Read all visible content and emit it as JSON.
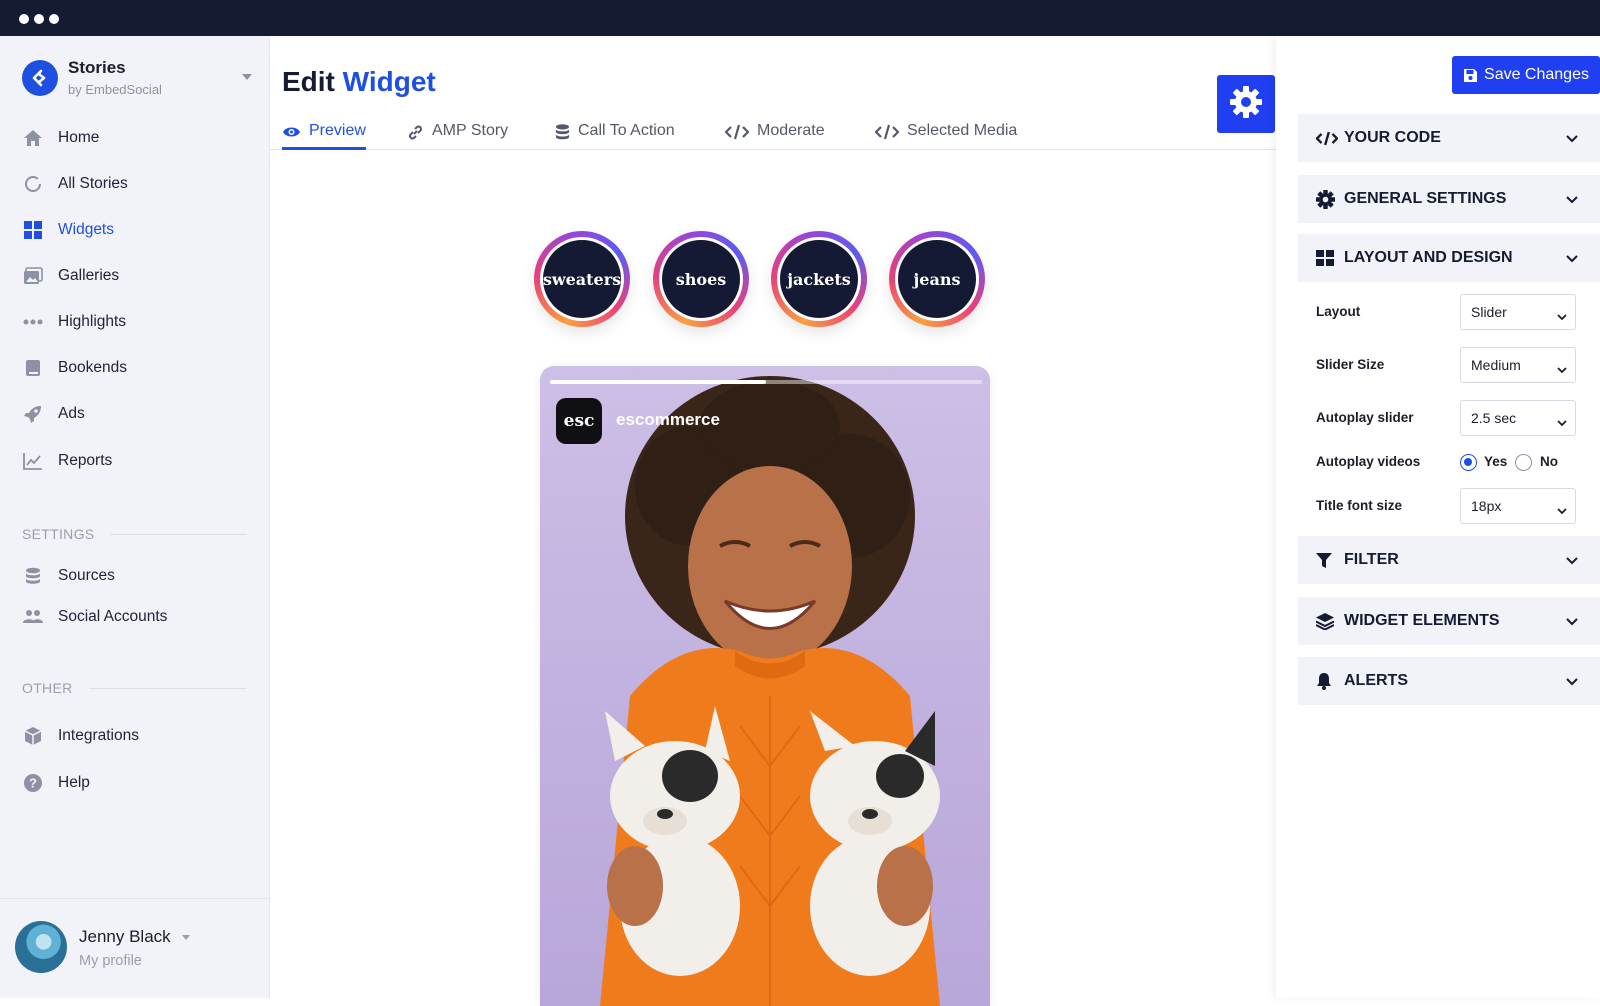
{
  "brand": {
    "title": "Stories",
    "subtitle": "by EmbedSocial"
  },
  "sidebar": {
    "items": [
      {
        "label": "Home",
        "icon": "home-icon"
      },
      {
        "label": "All Stories",
        "icon": "circle-icon"
      },
      {
        "label": "Widgets",
        "icon": "grid-icon",
        "active": true
      },
      {
        "label": "Galleries",
        "icon": "gallery-icon"
      },
      {
        "label": "Highlights",
        "icon": "dots-icon"
      },
      {
        "label": "Bookends",
        "icon": "book-icon"
      },
      {
        "label": "Ads",
        "icon": "rocket-icon"
      },
      {
        "label": "Reports",
        "icon": "chart-icon"
      }
    ],
    "settings_heading": "SETTINGS",
    "settings_items": [
      {
        "label": "Sources",
        "icon": "database-icon"
      },
      {
        "label": "Social Accounts",
        "icon": "users-icon"
      }
    ],
    "other_heading": "OTHER",
    "other_items": [
      {
        "label": "Integrations",
        "icon": "cube-icon"
      },
      {
        "label": "Help",
        "icon": "help-icon"
      }
    ]
  },
  "profile": {
    "name": "Jenny Black",
    "subtitle": "My profile"
  },
  "main": {
    "title_plain": "Edit",
    "title_accent": "Widget",
    "tabs": [
      {
        "label": "Preview",
        "active": true
      },
      {
        "label": "AMP Story"
      },
      {
        "label": "Call To Action"
      },
      {
        "label": "Moderate"
      },
      {
        "label": "Selected Media"
      }
    ],
    "bubbles": [
      "sweaters",
      "shoes",
      "jackets",
      "jeans"
    ],
    "story": {
      "avatar_text": "esc",
      "username": "escommerce",
      "progress": 0.5
    }
  },
  "panel": {
    "save_label": "Save Changes",
    "sections": {
      "your_code": "YOUR CODE",
      "general": "GENERAL SETTINGS",
      "layout": "LAYOUT AND DESIGN",
      "filter": "FILTER",
      "elements": "WIDGET ELEMENTS",
      "alerts": "ALERTS"
    },
    "fields": {
      "layout_label": "Layout",
      "layout_value": "Slider",
      "slider_size_label": "Slider Size",
      "slider_size_value": "Medium",
      "autoplay_slider_label": "Autoplay slider",
      "autoplay_slider_value": "2.5 sec",
      "autoplay_videos_label": "Autoplay videos",
      "autoplay_videos_yes": "Yes",
      "autoplay_videos_no": "No",
      "autoplay_videos_selected": "Yes",
      "title_font_label": "Title font size",
      "title_font_value": "18px"
    }
  },
  "colors": {
    "accent": "#1f4fe0",
    "button": "#1f3ff0",
    "topbar": "#151b33",
    "sidebar_bg": "#f2f3f8"
  }
}
